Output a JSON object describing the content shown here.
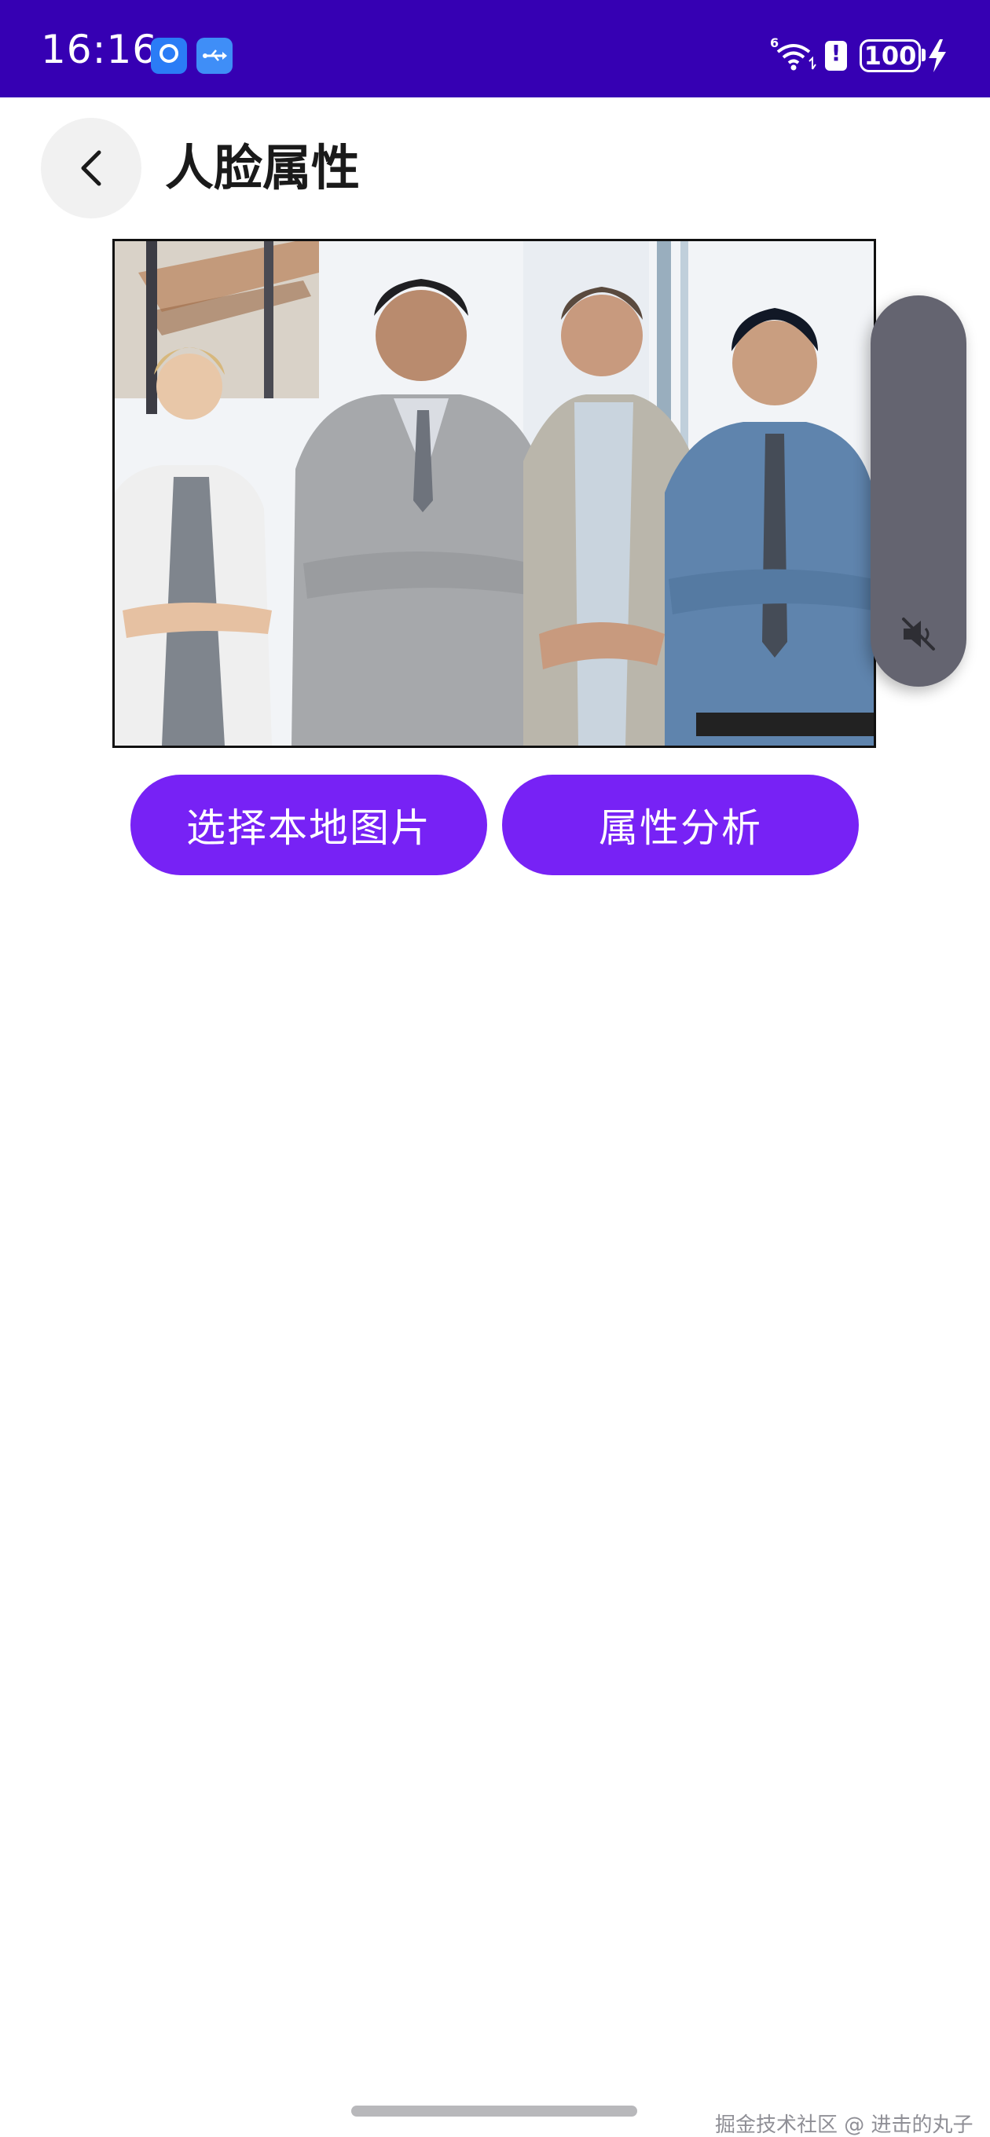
{
  "status_bar": {
    "time": "16:16",
    "battery": "100",
    "background_color": "#3600b3",
    "icons": [
      "app-icon",
      "usb-icon",
      "wifi-icon",
      "alert-icon",
      "battery-icon",
      "charging-icon"
    ]
  },
  "header": {
    "title": "人脸属性",
    "back_icon": "chevron-left-icon"
  },
  "image_preview": {
    "subject": "group-photo"
  },
  "actions": {
    "select_local_image": "选择本地图片",
    "attribute_analysis": "属性分析",
    "button_color": "#7722f5"
  },
  "volume_panel": {
    "icon": "volume-muted-icon",
    "muted": true
  },
  "watermark": "掘金技术社区 @ 进击的丸子"
}
